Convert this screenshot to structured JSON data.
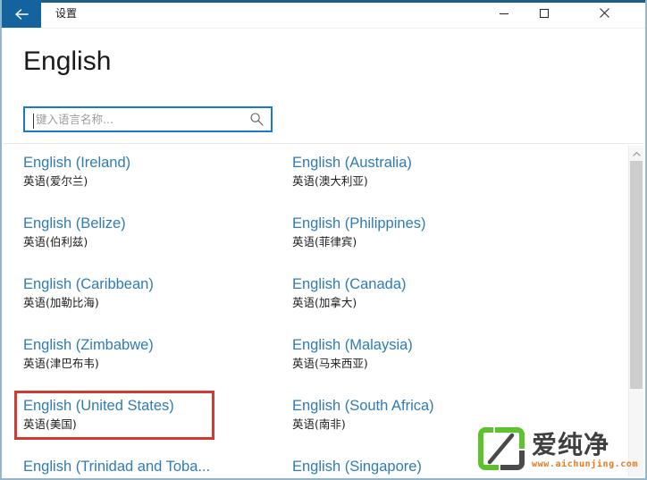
{
  "window": {
    "title": "设置",
    "back_icon": "back-arrow-icon",
    "controls": {
      "minimize": "minimize-icon",
      "maximize": "maximize-icon",
      "close": "close-icon"
    }
  },
  "header": {
    "page_title": "English"
  },
  "search": {
    "value": "",
    "placeholder": "键入语言名称...",
    "icon": "search-icon"
  },
  "list": {
    "columns": [
      {
        "items": [
          {
            "en": "English (Ireland)",
            "zh": "英语(爱尔兰)"
          },
          {
            "en": "English (Belize)",
            "zh": "英语(伯利兹)"
          },
          {
            "en": "English (Caribbean)",
            "zh": "英语(加勒比海)"
          },
          {
            "en": "English (Zimbabwe)",
            "zh": "英语(津巴布韦)"
          },
          {
            "en": "English (United States)",
            "zh": "英语(美国)"
          },
          {
            "en": "English (Trinidad and Toba...",
            "zh": ""
          }
        ]
      },
      {
        "items": [
          {
            "en": "English (Australia)",
            "zh": "英语(澳大利亚)"
          },
          {
            "en": "English (Philippines)",
            "zh": "英语(菲律宾)"
          },
          {
            "en": "English (Canada)",
            "zh": "英语(加拿大)"
          },
          {
            "en": "English (Malaysia)",
            "zh": "英语(马来西亚)"
          },
          {
            "en": "English (South Africa)",
            "zh": "英语(南非)"
          },
          {
            "en": "English (Singapore)",
            "zh": ""
          }
        ]
      }
    ]
  },
  "annotation": {
    "target": "English (United States)",
    "color": "#cf3a32"
  },
  "scrollbar": {
    "up_arrow_icon": "chevron-up-icon"
  },
  "watermark": {
    "brand": "爱纯净",
    "url": "www.aichunjing.com",
    "logo_color": "#5ec22e",
    "url_color": "#e8791f"
  },
  "colors": {
    "link": "#2e7cb5",
    "accent": "#14639e",
    "search_border": "#1979ca"
  }
}
